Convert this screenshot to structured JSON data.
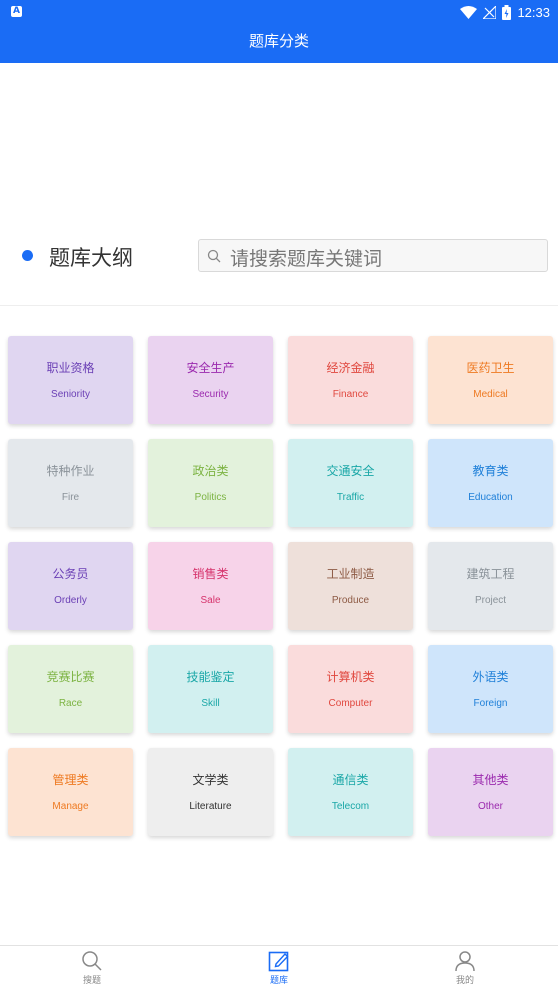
{
  "header": {
    "title": "题库分类",
    "time": "12:33"
  },
  "section": {
    "title": "题库大纲",
    "search_placeholder": "请搜索题库关键词"
  },
  "categories": [
    {
      "cn": "职业资格",
      "en": "Seniority",
      "bg": "#e0d6f1",
      "color": "#6a3fb5"
    },
    {
      "cn": "安全生产",
      "en": "Security",
      "bg": "#ead3f0",
      "color": "#9b2aae"
    },
    {
      "cn": "经济金融",
      "en": "Finance",
      "bg": "#fadcdc",
      "color": "#e0483f"
    },
    {
      "cn": "医药卫生",
      "en": "Medical",
      "bg": "#fde3d2",
      "color": "#ee7a22"
    },
    {
      "cn": "特种作业",
      "en": "Fire",
      "bg": "#e4e8ec",
      "color": "#8a9299"
    },
    {
      "cn": "政治类",
      "en": "Politics",
      "bg": "#e3f2dc",
      "color": "#7cb342"
    },
    {
      "cn": "交通安全",
      "en": "Traffic",
      "bg": "#d2f0f0",
      "color": "#1aa7a7"
    },
    {
      "cn": "教育类",
      "en": "Education",
      "bg": "#cfe5fb",
      "color": "#1e7fd8"
    },
    {
      "cn": "公务员",
      "en": "Orderly",
      "bg": "#e0d6f1",
      "color": "#6a3fb5"
    },
    {
      "cn": "销售类",
      "en": "Sale",
      "bg": "#f7d3e9",
      "color": "#d6336c"
    },
    {
      "cn": "工业制造",
      "en": "Produce",
      "bg": "#eee0da",
      "color": "#8d5a44"
    },
    {
      "cn": "建筑工程",
      "en": "Project",
      "bg": "#e4e8ec",
      "color": "#8a9299"
    },
    {
      "cn": "竞赛比赛",
      "en": "Race",
      "bg": "#e3f2dc",
      "color": "#7cb342"
    },
    {
      "cn": "技能鉴定",
      "en": "Skill",
      "bg": "#d2f0f0",
      "color": "#1aa7a7"
    },
    {
      "cn": "计算机类",
      "en": "Computer",
      "bg": "#fadcdc",
      "color": "#e0483f"
    },
    {
      "cn": "外语类",
      "en": "Foreign",
      "bg": "#cfe5fb",
      "color": "#1e7fd8"
    },
    {
      "cn": "管理类",
      "en": "Manage",
      "bg": "#fde3d2",
      "color": "#ee7a22"
    },
    {
      "cn": "文学类",
      "en": "Literature",
      "bg": "#eeeeee",
      "color": "#333333"
    },
    {
      "cn": "通信类",
      "en": "Telecom",
      "bg": "#d2f0f0",
      "color": "#1aa7a7"
    },
    {
      "cn": "其他类",
      "en": "Other",
      "bg": "#ead3f0",
      "color": "#9b2aae"
    }
  ],
  "nav": {
    "items": [
      {
        "label": "搜题",
        "icon": "search-icon"
      },
      {
        "label": "题库",
        "icon": "edit-icon"
      },
      {
        "label": "我的",
        "icon": "person-icon"
      }
    ],
    "active_color": "#1a6cf5"
  }
}
